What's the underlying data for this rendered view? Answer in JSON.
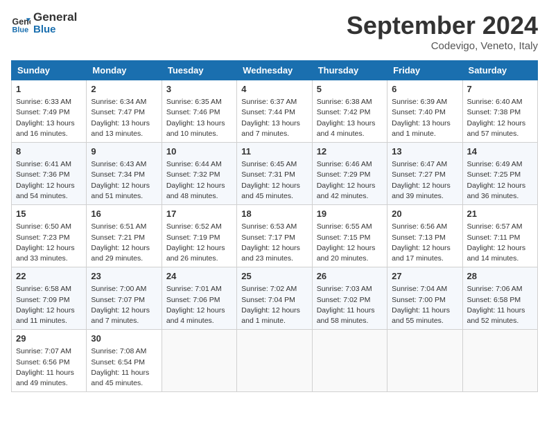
{
  "header": {
    "logo_line1": "General",
    "logo_line2": "Blue",
    "month_title": "September 2024",
    "location": "Codevigo, Veneto, Italy"
  },
  "columns": [
    "Sunday",
    "Monday",
    "Tuesday",
    "Wednesday",
    "Thursday",
    "Friday",
    "Saturday"
  ],
  "weeks": [
    [
      {
        "day": "1",
        "info": "Sunrise: 6:33 AM\nSunset: 7:49 PM\nDaylight: 13 hours\nand 16 minutes."
      },
      {
        "day": "2",
        "info": "Sunrise: 6:34 AM\nSunset: 7:47 PM\nDaylight: 13 hours\nand 13 minutes."
      },
      {
        "day": "3",
        "info": "Sunrise: 6:35 AM\nSunset: 7:46 PM\nDaylight: 13 hours\nand 10 minutes."
      },
      {
        "day": "4",
        "info": "Sunrise: 6:37 AM\nSunset: 7:44 PM\nDaylight: 13 hours\nand 7 minutes."
      },
      {
        "day": "5",
        "info": "Sunrise: 6:38 AM\nSunset: 7:42 PM\nDaylight: 13 hours\nand 4 minutes."
      },
      {
        "day": "6",
        "info": "Sunrise: 6:39 AM\nSunset: 7:40 PM\nDaylight: 13 hours\nand 1 minute."
      },
      {
        "day": "7",
        "info": "Sunrise: 6:40 AM\nSunset: 7:38 PM\nDaylight: 12 hours\nand 57 minutes."
      }
    ],
    [
      {
        "day": "8",
        "info": "Sunrise: 6:41 AM\nSunset: 7:36 PM\nDaylight: 12 hours\nand 54 minutes."
      },
      {
        "day": "9",
        "info": "Sunrise: 6:43 AM\nSunset: 7:34 PM\nDaylight: 12 hours\nand 51 minutes."
      },
      {
        "day": "10",
        "info": "Sunrise: 6:44 AM\nSunset: 7:32 PM\nDaylight: 12 hours\nand 48 minutes."
      },
      {
        "day": "11",
        "info": "Sunrise: 6:45 AM\nSunset: 7:31 PM\nDaylight: 12 hours\nand 45 minutes."
      },
      {
        "day": "12",
        "info": "Sunrise: 6:46 AM\nSunset: 7:29 PM\nDaylight: 12 hours\nand 42 minutes."
      },
      {
        "day": "13",
        "info": "Sunrise: 6:47 AM\nSunset: 7:27 PM\nDaylight: 12 hours\nand 39 minutes."
      },
      {
        "day": "14",
        "info": "Sunrise: 6:49 AM\nSunset: 7:25 PM\nDaylight: 12 hours\nand 36 minutes."
      }
    ],
    [
      {
        "day": "15",
        "info": "Sunrise: 6:50 AM\nSunset: 7:23 PM\nDaylight: 12 hours\nand 33 minutes."
      },
      {
        "day": "16",
        "info": "Sunrise: 6:51 AM\nSunset: 7:21 PM\nDaylight: 12 hours\nand 29 minutes."
      },
      {
        "day": "17",
        "info": "Sunrise: 6:52 AM\nSunset: 7:19 PM\nDaylight: 12 hours\nand 26 minutes."
      },
      {
        "day": "18",
        "info": "Sunrise: 6:53 AM\nSunset: 7:17 PM\nDaylight: 12 hours\nand 23 minutes."
      },
      {
        "day": "19",
        "info": "Sunrise: 6:55 AM\nSunset: 7:15 PM\nDaylight: 12 hours\nand 20 minutes."
      },
      {
        "day": "20",
        "info": "Sunrise: 6:56 AM\nSunset: 7:13 PM\nDaylight: 12 hours\nand 17 minutes."
      },
      {
        "day": "21",
        "info": "Sunrise: 6:57 AM\nSunset: 7:11 PM\nDaylight: 12 hours\nand 14 minutes."
      }
    ],
    [
      {
        "day": "22",
        "info": "Sunrise: 6:58 AM\nSunset: 7:09 PM\nDaylight: 12 hours\nand 11 minutes."
      },
      {
        "day": "23",
        "info": "Sunrise: 7:00 AM\nSunset: 7:07 PM\nDaylight: 12 hours\nand 7 minutes."
      },
      {
        "day": "24",
        "info": "Sunrise: 7:01 AM\nSunset: 7:06 PM\nDaylight: 12 hours\nand 4 minutes."
      },
      {
        "day": "25",
        "info": "Sunrise: 7:02 AM\nSunset: 7:04 PM\nDaylight: 12 hours\nand 1 minute."
      },
      {
        "day": "26",
        "info": "Sunrise: 7:03 AM\nSunset: 7:02 PM\nDaylight: 11 hours\nand 58 minutes."
      },
      {
        "day": "27",
        "info": "Sunrise: 7:04 AM\nSunset: 7:00 PM\nDaylight: 11 hours\nand 55 minutes."
      },
      {
        "day": "28",
        "info": "Sunrise: 7:06 AM\nSunset: 6:58 PM\nDaylight: 11 hours\nand 52 minutes."
      }
    ],
    [
      {
        "day": "29",
        "info": "Sunrise: 7:07 AM\nSunset: 6:56 PM\nDaylight: 11 hours\nand 49 minutes."
      },
      {
        "day": "30",
        "info": "Sunrise: 7:08 AM\nSunset: 6:54 PM\nDaylight: 11 hours\nand 45 minutes."
      },
      {
        "day": "",
        "info": ""
      },
      {
        "day": "",
        "info": ""
      },
      {
        "day": "",
        "info": ""
      },
      {
        "day": "",
        "info": ""
      },
      {
        "day": "",
        "info": ""
      }
    ]
  ]
}
